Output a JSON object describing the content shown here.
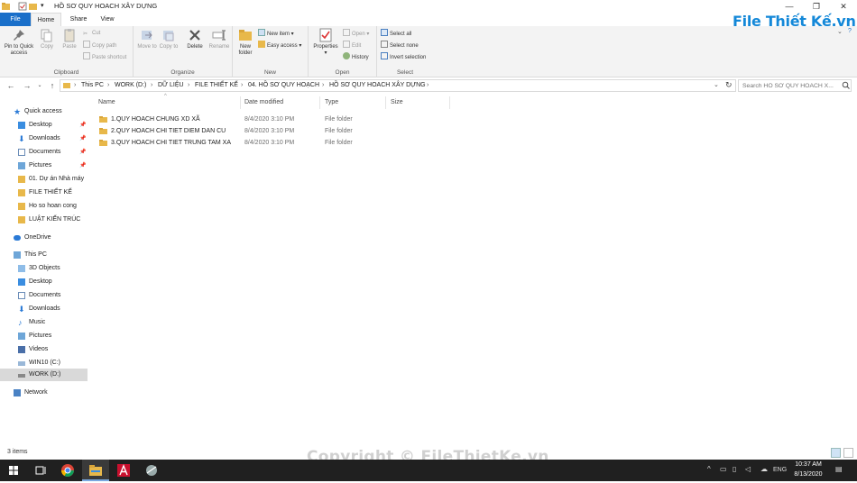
{
  "window": {
    "title": "HỒ SƠ QUY HOACH XÂY DỰNG",
    "controls": [
      "—",
      "❐",
      "✕"
    ]
  },
  "ribbon_tabs": [
    "File",
    "Home",
    "Share",
    "View"
  ],
  "logo_text": "File Thiết Kế.vn",
  "ribbon": {
    "clipboard": {
      "label": "Clipboard",
      "pin": "Pin to Quick access",
      "copy": "Copy",
      "paste": "Paste",
      "cut": "Cut",
      "copy_path": "Copy path",
      "paste_shortcut": "Paste shortcut"
    },
    "organize": {
      "label": "Organize",
      "move_to": "Move to",
      "copy_to": "Copy to",
      "delete": "Delete",
      "rename": "Rename"
    },
    "new": {
      "label": "New",
      "new_folder": "New folder",
      "new_item": "New item",
      "easy_access": "Easy access"
    },
    "open": {
      "label": "Open",
      "properties": "Properties",
      "open": "Open",
      "edit": "Edit",
      "history": "History"
    },
    "select": {
      "label": "Select",
      "select_all": "Select all",
      "select_none": "Select none",
      "invert_selection": "Invert selection"
    }
  },
  "breadcrumb": [
    "This PC",
    "WORK (D:)",
    "DỮ LIỆU",
    "FILE THIẾT KẾ",
    "04. HỒ SƠ QUY HOẠCH",
    "HỒ SƠ QUY HOACH XÂY DỰNG"
  ],
  "search": {
    "placeholder": "Search HỒ SƠ QUY HOACH X..."
  },
  "nav": {
    "quick_access": "Quick access",
    "pinned": [
      "Desktop",
      "Downloads",
      "Documents",
      "Pictures"
    ],
    "recent": [
      "01. Dự án Nhà máy",
      "FILE THIẾT KẾ",
      "Ho so hoan cong",
      "LUẬT KIẾN TRÚC"
    ],
    "onedrive": "OneDrive",
    "this_pc": "This PC",
    "this_pc_items": [
      "3D Objects",
      "Desktop",
      "Documents",
      "Downloads",
      "Music",
      "Pictures",
      "Videos",
      "WIN10 (C:)",
      "WORK (D:)"
    ],
    "network": "Network"
  },
  "columns": {
    "name": "Name",
    "date": "Date modified",
    "type": "Type",
    "size": "Size"
  },
  "files": [
    {
      "name": "1.QUY HOACH CHUNG XD XÃ",
      "date": "8/4/2020 3:10 PM",
      "type": "File folder"
    },
    {
      "name": "2.QUY HOACH CHI TIET DIEM DAN CU",
      "date": "8/4/2020 3:10 PM",
      "type": "File folder"
    },
    {
      "name": "3.QUY HOACH CHI TIET TRUNG TAM XA",
      "date": "8/4/2020 3:10 PM",
      "type": "File folder"
    }
  ],
  "status": {
    "item_count": "3 items"
  },
  "watermark": "Copyright © FileThietKe.vn",
  "taskbar": {
    "language": "ENG",
    "time": "10:37 AM",
    "date": "8/13/2020"
  },
  "colors": {
    "accent": "#1a6fc9",
    "folder": "#e8b84a",
    "taskbar": "#202020"
  }
}
